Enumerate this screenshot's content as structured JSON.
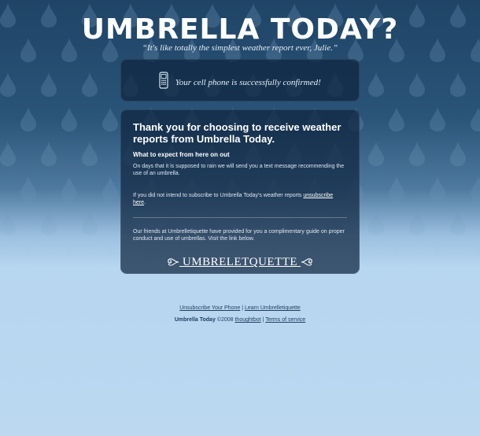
{
  "header": {
    "title": "UMBRELLA TODAY?",
    "tagline": "“It's like totally the simplest weather report ever, Julie.”"
  },
  "confirmation": {
    "icon": "cell-phone-icon",
    "message": "Your cell phone is successfully confirmed!"
  },
  "content": {
    "heading": "Thank you for choosing to receive weather reports from Umbrella Today.",
    "subheading": "What to expect from here on out",
    "rain_text": "On days that it is supposed to rain we will send you a text message recommending the use of an umbrella.",
    "unsub_text": "If you did not intend to subscribe to Umbrella Today's weather reports ",
    "unsub_link": "unsubscribe here",
    "unsub_end": ".",
    "friends_text": "Our friends at Umbrelletiquette have provided for you a complimentary guide on proper conduct and use of umbrellas. Visit the link below.",
    "logo_text": "UMBRELETQUETTE"
  },
  "footer": {
    "unsubscribe_link": "Unsubscribe Your Phone",
    "separator": "|",
    "learn_link": "Learn Umbrelletiquette",
    "brand": "Umbrella Today",
    "copyright": "©2008",
    "thoughtbot_link": "thoughtbot",
    "terms_link": "Terms of service"
  },
  "colors": {
    "background_top": "#1f4466",
    "background_bottom": "#bcd8f1",
    "panel": "#0e243e",
    "footer_text": "#1f3f60"
  }
}
